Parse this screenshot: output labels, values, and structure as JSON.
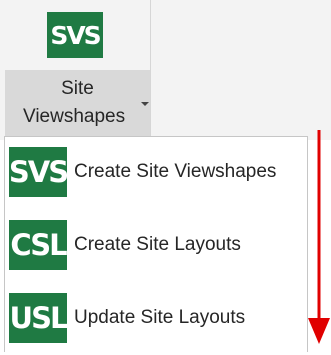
{
  "ribbon": {
    "button": {
      "icon_text": "SVS",
      "label_line1": "Site",
      "label_line2": "Viewshapes"
    }
  },
  "menu": {
    "items": [
      {
        "icon_text": "SVS",
        "label": "Create Site Viewshapes"
      },
      {
        "icon_text": "CSL",
        "label": "Create Site Layouts"
      },
      {
        "icon_text": "USL",
        "label": "Update Site Layouts"
      }
    ]
  },
  "colors": {
    "icon_green": "#1f7a43",
    "arrow_red": "#e00000",
    "ribbon_bg": "#f3f3f3",
    "hover_bg": "#d9d9d9"
  },
  "icons": {
    "ribbon_button": "svs-logo-icon",
    "menu_items": [
      "svs-logo-icon",
      "csl-logo-icon",
      "usl-logo-icon"
    ],
    "dropdown": "caret-down-icon",
    "annotation": "red-down-arrow-icon"
  }
}
